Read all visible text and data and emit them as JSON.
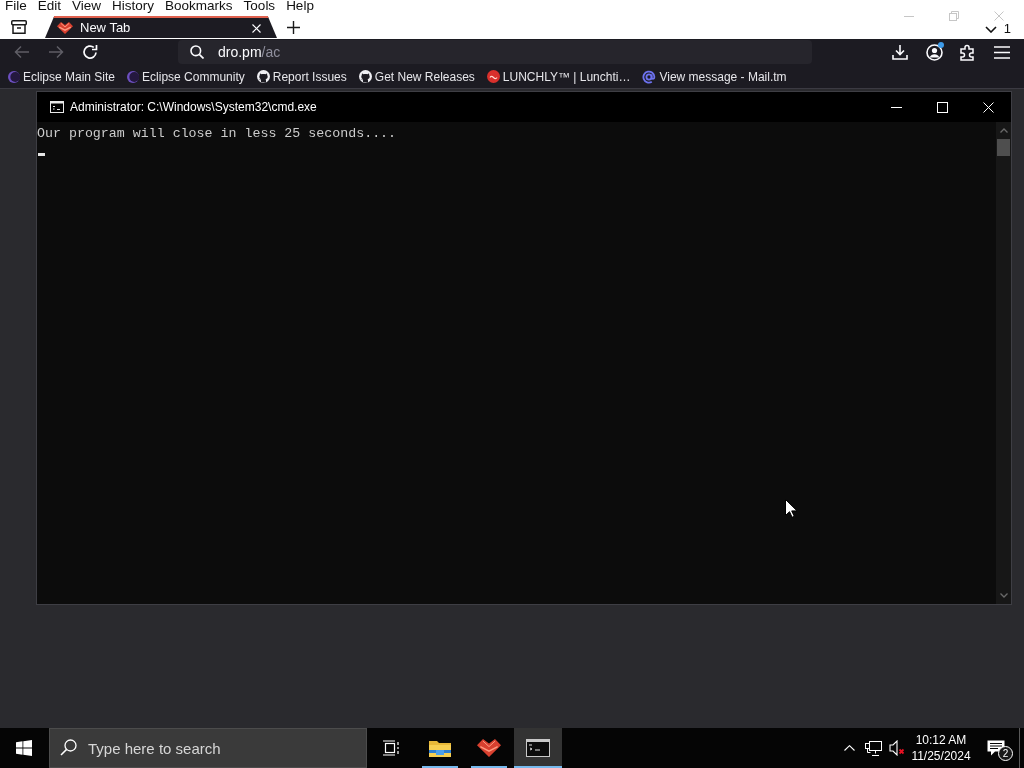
{
  "menu_bar": {
    "items": [
      "File",
      "Edit",
      "View",
      "History",
      "Bookmarks",
      "Tools",
      "Help"
    ]
  },
  "corner_indicator": "1",
  "tabs": [
    {
      "title": "New Tab",
      "selected": true
    }
  ],
  "navigation": {
    "buttons": [
      {
        "kind": "back",
        "disabled": true
      },
      {
        "kind": "forward",
        "disabled": true
      },
      {
        "kind": "reload",
        "disabled": false
      }
    ],
    "url_host": "dro.pm",
    "url_path": "/ac",
    "toolbar": [
      {
        "kind": "downloads"
      },
      {
        "kind": "account",
        "badge": true
      },
      {
        "kind": "extensions"
      },
      {
        "kind": "menu"
      }
    ]
  },
  "bookmarks": [
    {
      "label": "Eclipse Main Site",
      "kind": "eclipse"
    },
    {
      "label": "Eclipse Community",
      "kind": "eclipse"
    },
    {
      "label": "Report Issues",
      "kind": "github"
    },
    {
      "label": "Get New Releases",
      "kind": "github"
    },
    {
      "label": "LUNCHLY™ | Lunchti…",
      "kind": "lunchly"
    },
    {
      "label": "View message - Mail.tm",
      "kind": "mail"
    }
  ],
  "console_window": {
    "title": "Administrator: C:\\Windows\\System32\\cmd.exe",
    "lines": [
      "Our program will close in less 25 seconds...."
    ],
    "cursor": true
  },
  "taskbar": {
    "search": {
      "placeholder": "Type here to search"
    },
    "apps": [
      {
        "kind": "task_view",
        "running": false,
        "selected": false
      },
      {
        "kind": "file_explorer",
        "running": true,
        "selected": false
      },
      {
        "kind": "browser",
        "running": true,
        "selected": false
      },
      {
        "kind": "terminal",
        "running": true,
        "selected": true
      }
    ],
    "tray": {
      "volume_muted": true,
      "time": "10:12 AM",
      "date": "11/25/2024",
      "notifications": "2"
    }
  }
}
